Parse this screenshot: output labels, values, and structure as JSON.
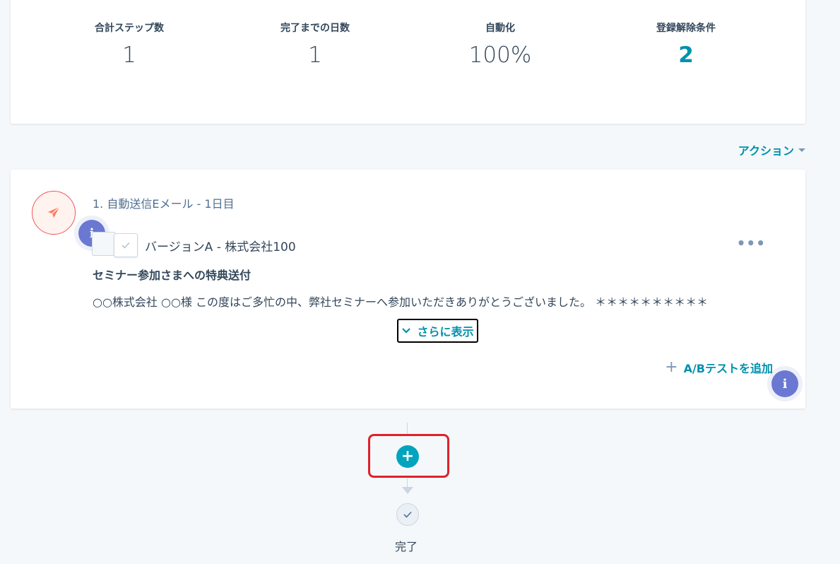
{
  "stats": [
    {
      "label": "合計ステップ数",
      "value": "1"
    },
    {
      "label": "完了までの日数",
      "value": "1"
    },
    {
      "label": "自動化",
      "value": "100%"
    },
    {
      "label": "登録解除条件",
      "value": "2"
    }
  ],
  "actions": {
    "label": "アクション"
  },
  "step": {
    "title": "1. 自動送信Eメール - 1日目",
    "version_label": "バージョンA - 株式会社100",
    "subject": "セミナー参加さまへの特典送付",
    "preview": "○○株式会社 ○○様 この度はご多忙の中、弊社セミナーへ参加いただきありがとうございました。 ＊＊＊＊＊＊＊＊＊＊",
    "show_more": "さらに表示",
    "ab_test": "A/Bテストを追加",
    "more_dots": "•••",
    "info_glyph": "i"
  },
  "flow": {
    "add_glyph": "+",
    "done_label": "完了"
  },
  "colors": {
    "accent": "#0091ae",
    "add_button": "#00a4bd",
    "info_badge": "#6a78d1",
    "email_icon": "#ff7a59",
    "highlight": "#e0212c"
  },
  "icons": [
    "paper-plane-icon",
    "info-icon",
    "check-icon",
    "chevron-down-icon",
    "plus-icon",
    "caret-down-icon"
  ]
}
